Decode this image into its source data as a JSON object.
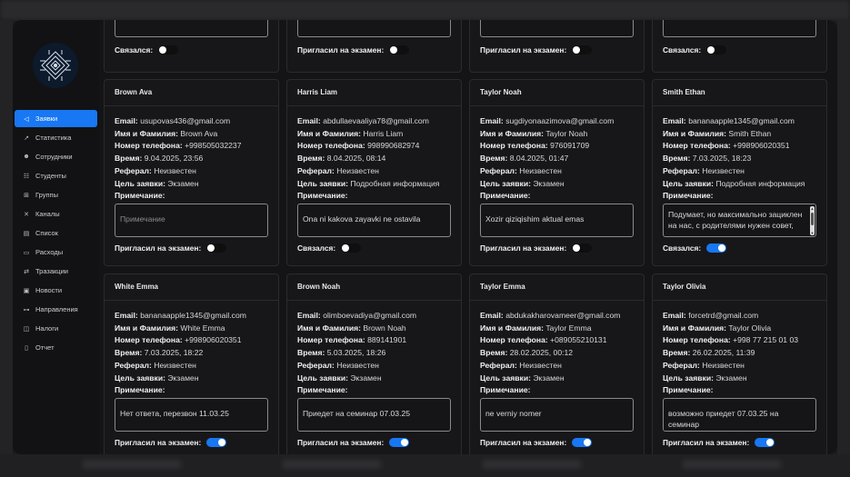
{
  "sidebar": {
    "items": [
      {
        "label": "Заявки",
        "icon": "send-icon",
        "glyph": "◁",
        "active": true
      },
      {
        "label": "Статистика",
        "icon": "chart-icon",
        "glyph": "↗",
        "active": false
      },
      {
        "label": "Сотрудники",
        "icon": "users-icon",
        "glyph": "☻",
        "active": false
      },
      {
        "label": "Студенты",
        "icon": "students-icon",
        "glyph": "☷",
        "active": false
      },
      {
        "label": "Группы",
        "icon": "groups-icon",
        "glyph": "⊞",
        "active": false
      },
      {
        "label": "Каналы",
        "icon": "channels-icon",
        "glyph": "✕",
        "active": false
      },
      {
        "label": "Список",
        "icon": "list-icon",
        "glyph": "▤",
        "active": false
      },
      {
        "label": "Расходы",
        "icon": "expenses-icon",
        "glyph": "▭",
        "active": false
      },
      {
        "label": "Тразакции",
        "icon": "transactions-icon",
        "glyph": "⇄",
        "active": false
      },
      {
        "label": "Новости",
        "icon": "news-icon",
        "glyph": "▣",
        "active": false
      },
      {
        "label": "Направления",
        "icon": "directions-icon",
        "glyph": "⊶",
        "active": false
      },
      {
        "label": "Налоги",
        "icon": "taxes-icon",
        "glyph": "◫",
        "active": false
      },
      {
        "label": "Отчет",
        "icon": "report-icon",
        "glyph": "▯",
        "active": false
      }
    ]
  },
  "labels": {
    "email": "Email:",
    "name": "Имя и Фамилия:",
    "phone": "Номер телефона:",
    "time": "Время:",
    "referral": "Реферал:",
    "goal": "Цель заявки:",
    "note": "Примечание:",
    "note_placeholder": "Примечание",
    "contacted": "Связался:",
    "invited": "Пригласил на экзамен:"
  },
  "top_cards": [
    {
      "toggle_label": "Связался:",
      "toggle_on": false
    },
    {
      "toggle_label": "Пригласил на экзамен:",
      "toggle_on": false
    },
    {
      "toggle_label": "Пригласил на экзамен:",
      "toggle_on": false
    },
    {
      "toggle_label": "Связался:",
      "toggle_on": false
    }
  ],
  "cards": [
    {
      "title": "Brown Ava",
      "email": "usupovas436@gmail.com",
      "name": "Brown Ava",
      "phone": "+998505032237",
      "time": "9.04.2025, 23:56",
      "referral": "Неизвестен",
      "goal": "Экзамен",
      "note": "",
      "toggle_label": "Пригласил на экзамен:",
      "toggle_on": false
    },
    {
      "title": "Harris Liam",
      "email": "abdullaevaaliya78@gmail.com",
      "name": "Harris Liam",
      "phone": "998990682974",
      "time": "8.04.2025, 08:14",
      "referral": "Неизвестен",
      "goal": "Подробная информация",
      "note": "Ona ni kakova zayavki ne ostavila",
      "toggle_label": "Связался:",
      "toggle_on": false
    },
    {
      "title": "Taylor Noah",
      "email": "sugdiyonaazimova@gmail.com",
      "name": "Taylor Noah",
      "phone": "976091709",
      "time": "8.04.2025, 01:47",
      "referral": "Неизвестен",
      "goal": "Экзамен",
      "note": "Xozir qiziqishim aktual emas",
      "toggle_label": "Пригласил на экзамен:",
      "toggle_on": false
    },
    {
      "title": "Smith Ethan",
      "email": "bananaapple1345@gmail.com",
      "name": "Smith Ethan",
      "phone": "+998906020351",
      "time": "7.03.2025, 18:23",
      "referral": "Неизвестен",
      "goal": "Подробная информация",
      "note": "Подумает, но максимально зациклен на нас, с родителями нужен совет,",
      "toggle_label": "Связался:",
      "toggle_on": true
    },
    {
      "title": "White Emma",
      "email": "bananaapple1345@gmail.com",
      "name": "White Emma",
      "phone": "+998906020351",
      "time": "7.03.2025, 18:22",
      "referral": "Неизвестен",
      "goal": "Экзамен",
      "note": "Нет ответа, перезвон 11.03.25",
      "toggle_label": "Пригласил на экзамен:",
      "toggle_on": true
    },
    {
      "title": "Brown Noah",
      "email": "olimboevadiya@gmail.com",
      "name": "Brown Noah",
      "phone": "889141901",
      "time": "5.03.2025, 18:26",
      "referral": "Неизвестен",
      "goal": "Экзамен",
      "note": "Приедет на семинар 07.03.25",
      "toggle_label": "Пригласил на экзамен:",
      "toggle_on": true
    },
    {
      "title": "Taylor Emma",
      "email": "abdukakharovameer@gmail.com",
      "name": "Taylor Emma",
      "phone": "+089055210131",
      "time": "28.02.2025, 00:12",
      "referral": "Неизвестен",
      "goal": "Экзамен",
      "note": "ne verniy nomer",
      "toggle_label": "Пригласил на экзамен:",
      "toggle_on": true
    },
    {
      "title": "Taylor Olivia",
      "email": "forcetrd@gmail.com",
      "name": "Taylor Olivia",
      "phone": "+998 77 215 01 03",
      "time": "26.02.2025, 11:39",
      "referral": "Неизвестен",
      "goal": "Экзамен",
      "note": "возможно приедет 07.03.25 на семинар",
      "toggle_label": "Пригласил на экзамен:",
      "toggle_on": true
    }
  ]
}
